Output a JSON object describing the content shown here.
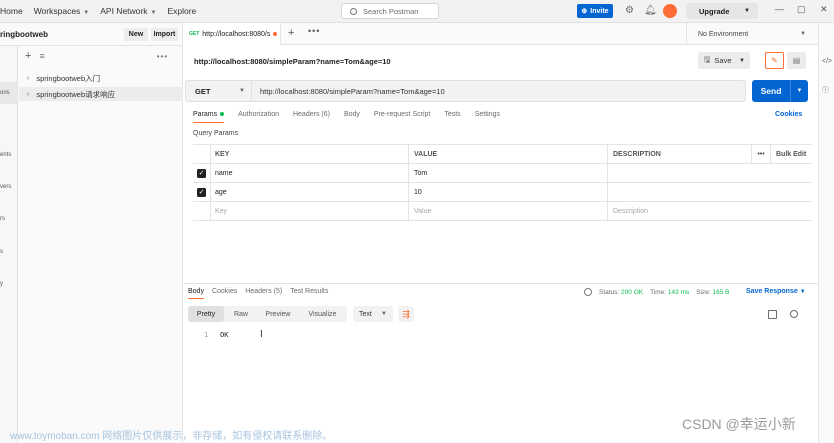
{
  "topbar": {
    "nav": [
      {
        "label": "Home",
        "caret": false
      },
      {
        "label": "Workspaces",
        "caret": true
      },
      {
        "label": "API Network",
        "caret": true
      },
      {
        "label": "Explore",
        "caret": false
      }
    ],
    "search_placeholder": "Search Postman",
    "invite_label": "Invite",
    "upgrade_label": "Upgrade"
  },
  "sidebar": {
    "workspace_name": "ringbootweb",
    "new_label": "New",
    "import_label": "Import",
    "rail_labels": [
      "ons",
      "ents",
      "vers",
      "rs",
      "s",
      "y"
    ],
    "tree": [
      {
        "label": "springbootweb入门"
      },
      {
        "label": "springbootweb请求响应"
      }
    ]
  },
  "tabs": {
    "active_tab": {
      "method": "GET",
      "label": "http://localhost:8080/s"
    },
    "environment": "No Environment"
  },
  "request": {
    "title": "http://localhost:8080/simpleParam?name=Tom&age=10",
    "save_label": "Save",
    "method": "GET",
    "url": "http://localhost:8080/simpleParam?name=Tom&age=10",
    "send_label": "Send",
    "tabs": [
      "Params",
      "Authorization",
      "Headers (6)",
      "Body",
      "Pre-request Script",
      "Tests",
      "Settings"
    ],
    "cookies_label": "Cookies",
    "query_params_label": "Query Params",
    "table_headers": {
      "key": "KEY",
      "value": "VALUE",
      "description": "DESCRIPTION",
      "more": "•••",
      "bulk": "Bulk Edit"
    },
    "params": [
      {
        "key": "name",
        "value": "Tom",
        "checked": true
      },
      {
        "key": "age",
        "value": "10",
        "checked": true
      }
    ],
    "placeholders": {
      "key": "Key",
      "value": "Value",
      "description": "Description"
    }
  },
  "response": {
    "tabs": [
      "Body",
      "Cookies",
      "Headers (5)",
      "Test Results"
    ],
    "status_label": "Status:",
    "status_value": "200 OK",
    "time_label": "Time:",
    "time_value": "143 ms",
    "size_label": "Size:",
    "size_value": "165 B",
    "save_response_label": "Save Response",
    "formats": [
      "Pretty",
      "Raw",
      "Preview",
      "Visualize"
    ],
    "text_type": "Text",
    "lines": [
      {
        "num": "1",
        "text": "OK"
      }
    ]
  },
  "overlay": {
    "watermark": "www.toymoban.com 网络图片仅供展示，非存储，如有侵权请联系删除。",
    "csdn_mark": "CSDN @幸运小新"
  },
  "colors": {
    "accent_orange": "#ff6c37",
    "primary_blue": "#0265d2",
    "status_green": "#0cbb52"
  }
}
